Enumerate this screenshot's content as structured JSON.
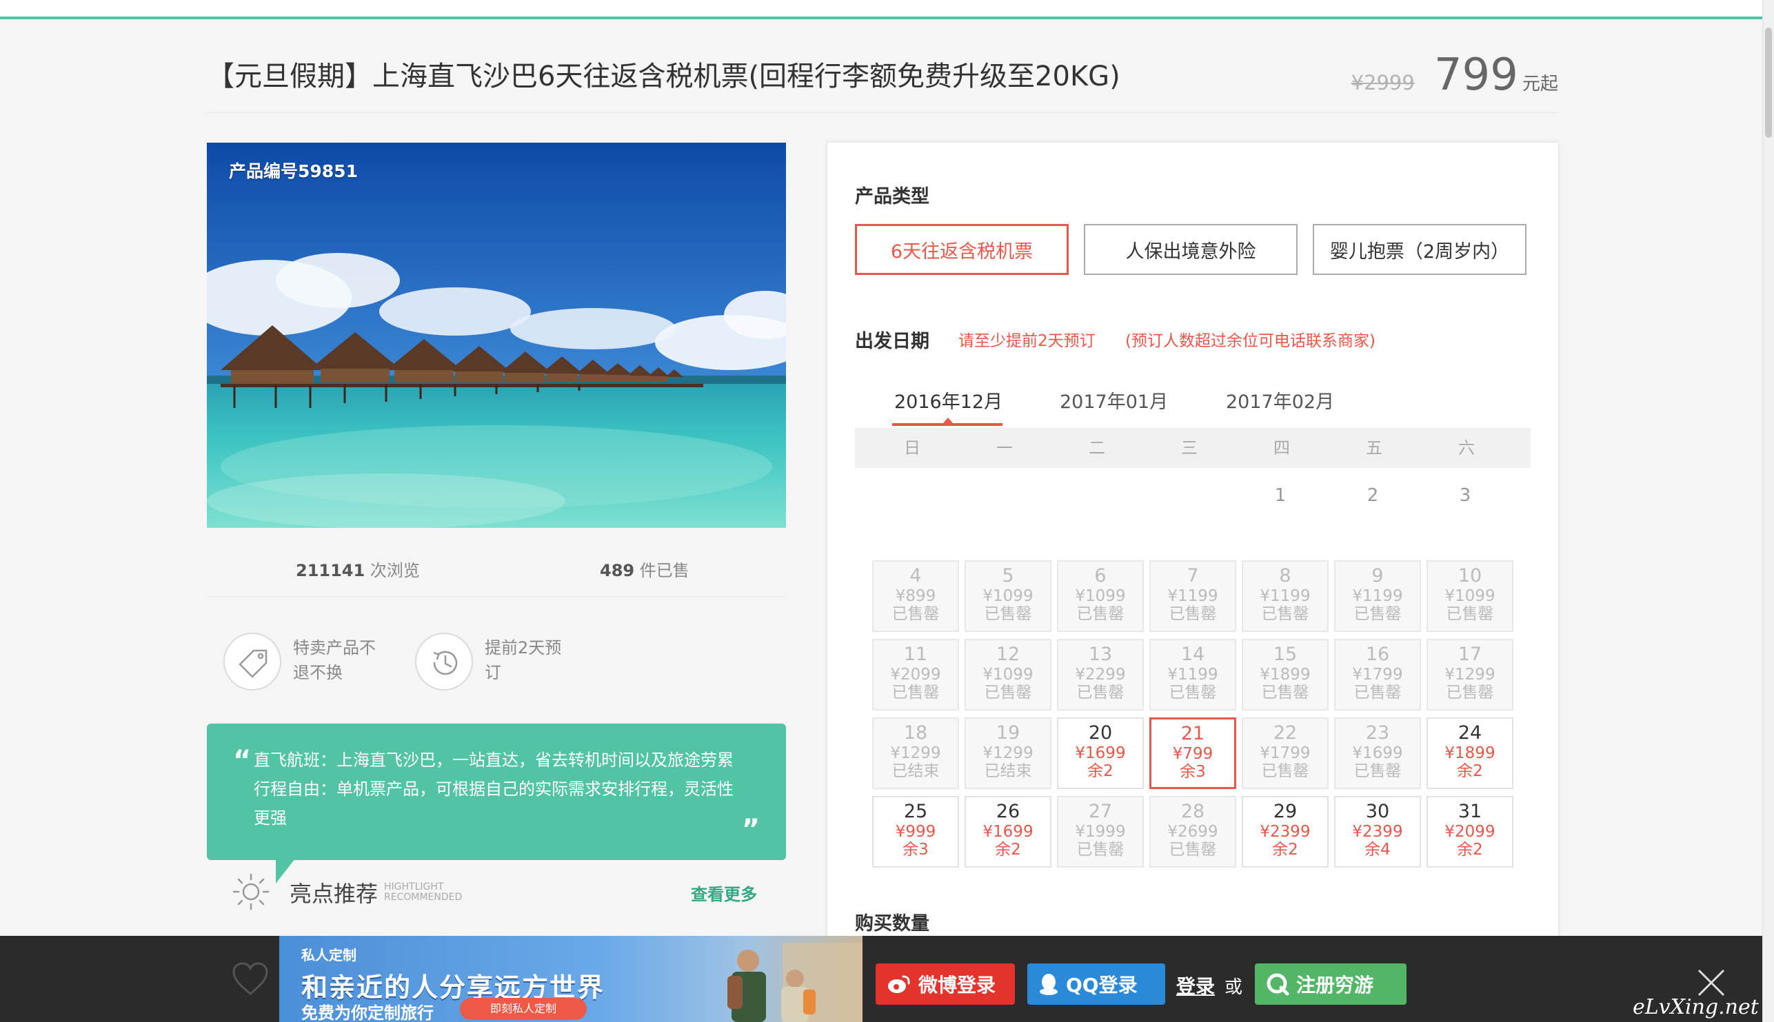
{
  "product": {
    "title": "【元旦假期】上海直飞沙巴6天往返含税机票(回程行李额免费升级至20KG)",
    "old_price": "¥2999",
    "price": "799",
    "price_suffix": "元起",
    "product_no": "产品编号59851"
  },
  "stats": {
    "views_num": "211141",
    "views_label": "次浏览",
    "sold_num": "489",
    "sold_label": "件已售"
  },
  "features": [
    {
      "icon": "tag-icon",
      "text": "特卖产品不退不换"
    },
    {
      "icon": "clock-icon",
      "text": "提前2天预订"
    }
  ],
  "quote": {
    "open": "“",
    "close": "”",
    "lines": [
      "直飞航班：上海直飞沙巴，一站直达，省去转机时间以及旅途劳累",
      "行程自由：单机票产品，可根据自己的实际需求安排行程，灵活性",
      "更强"
    ]
  },
  "highlight": {
    "title": "亮点推荐",
    "en_line1": "HIGHTLIGHT",
    "en_line2": "RECOMMENDED",
    "more": "查看更多"
  },
  "booking": {
    "type_label": "产品类型",
    "types": [
      {
        "label": "6天往返含税机票",
        "active": true
      },
      {
        "label": "人保出境意外险",
        "active": false
      },
      {
        "label": "婴儿抱票（2周岁内）",
        "active": false
      }
    ],
    "date_label": "出发日期",
    "notice1": "请至少提前2天预订",
    "notice2": "(预订人数超过余位可电话联系商家)",
    "months": [
      "2016年12月",
      "2017年01月",
      "2017年02月"
    ],
    "weekdays": [
      "日",
      "一",
      "二",
      "三",
      "四",
      "五",
      "六"
    ],
    "first_days": [
      "1",
      "2",
      "3"
    ],
    "weeks": [
      [
        {
          "d": "4",
          "p": "¥899",
          "s": "已售罄",
          "state": "soldout"
        },
        {
          "d": "5",
          "p": "¥1099",
          "s": "已售罄",
          "state": "soldout"
        },
        {
          "d": "6",
          "p": "¥1099",
          "s": "已售罄",
          "state": "soldout"
        },
        {
          "d": "7",
          "p": "¥1199",
          "s": "已售罄",
          "state": "soldout"
        },
        {
          "d": "8",
          "p": "¥1199",
          "s": "已售罄",
          "state": "soldout"
        },
        {
          "d": "9",
          "p": "¥1199",
          "s": "已售罄",
          "state": "soldout"
        },
        {
          "d": "10",
          "p": "¥1099",
          "s": "已售罄",
          "state": "soldout"
        }
      ],
      [
        {
          "d": "11",
          "p": "¥2099",
          "s": "已售罄",
          "state": "soldout"
        },
        {
          "d": "12",
          "p": "¥1099",
          "s": "已售罄",
          "state": "soldout"
        },
        {
          "d": "13",
          "p": "¥2299",
          "s": "已售罄",
          "state": "soldout"
        },
        {
          "d": "14",
          "p": "¥1199",
          "s": "已售罄",
          "state": "soldout"
        },
        {
          "d": "15",
          "p": "¥1899",
          "s": "已售罄",
          "state": "soldout"
        },
        {
          "d": "16",
          "p": "¥1799",
          "s": "已售罄",
          "state": "soldout"
        },
        {
          "d": "17",
          "p": "¥1299",
          "s": "已售罄",
          "state": "soldout"
        }
      ],
      [
        {
          "d": "18",
          "p": "¥1299",
          "s": "已结束",
          "state": "ended"
        },
        {
          "d": "19",
          "p": "¥1299",
          "s": "已结束",
          "state": "ended"
        },
        {
          "d": "20",
          "p": "¥1699",
          "s": "余2",
          "state": "avail"
        },
        {
          "d": "21",
          "p": "¥799",
          "s": "余3",
          "state": "selected"
        },
        {
          "d": "22",
          "p": "¥1799",
          "s": "已售罄",
          "state": "soldout"
        },
        {
          "d": "23",
          "p": "¥1699",
          "s": "已售罄",
          "state": "soldout"
        },
        {
          "d": "24",
          "p": "¥1899",
          "s": "余2",
          "state": "avail"
        }
      ],
      [
        {
          "d": "25",
          "p": "¥999",
          "s": "余3",
          "state": "avail"
        },
        {
          "d": "26",
          "p": "¥1699",
          "s": "余2",
          "state": "avail"
        },
        {
          "d": "27",
          "p": "¥1999",
          "s": "已售罄",
          "state": "soldout"
        },
        {
          "d": "28",
          "p": "¥2699",
          "s": "已售罄",
          "state": "soldout"
        },
        {
          "d": "29",
          "p": "¥2399",
          "s": "余2",
          "state": "avail"
        },
        {
          "d": "30",
          "p": "¥2399",
          "s": "余4",
          "state": "avail"
        },
        {
          "d": "31",
          "p": "¥2099",
          "s": "余2",
          "state": "avail"
        }
      ]
    ],
    "qty_label": "购买数量"
  },
  "footer": {
    "banner_tag": "私人定制",
    "banner_main": "和亲近的人分享远方世界",
    "banner_sub": "免费为你定制旅行",
    "banner_btn": "即刻私人定制",
    "weibo_login": "微博登录",
    "qq_login": "QQ登录",
    "login": "登录",
    "or": "或",
    "register": "注册穷游",
    "watermark": "eLvXing.net"
  },
  "colors": {
    "accent_green": "#52c3a4",
    "accent_red": "#e8574a",
    "weibo_red": "#e2342c",
    "qq_blue": "#2a8ad8",
    "register_green": "#53b667"
  }
}
